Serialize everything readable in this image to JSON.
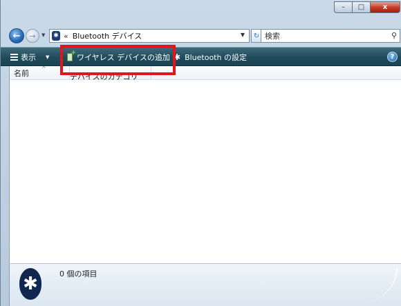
{
  "window": {
    "minimize_glyph": "–",
    "maximize_glyph": "□",
    "close_glyph": "x"
  },
  "nav": {
    "back_glyph": "←",
    "forward_glyph": "→"
  },
  "address": {
    "separator": "«",
    "path": "Bluetooth デバイス"
  },
  "search": {
    "placeholder": "検索"
  },
  "toolbar": {
    "views_label": "表示",
    "add_device_label": "ワイヤレス デバイスの追加",
    "bluetooth_settings_label": "Bluetooth の設定",
    "help_glyph": "?"
  },
  "columns": {
    "name": "名前",
    "category": "デバイスのカテゴリ"
  },
  "details": {
    "item_count": "0 個の項目"
  },
  "icons": {
    "bluetooth": "bluetooth-icon",
    "views": "views-icon",
    "add_device": "add-device-icon",
    "search": "search-icon",
    "refresh": "refresh-icon",
    "help": "help-icon"
  },
  "colors": {
    "toolbar": "#1f4b5c",
    "highlight": "#e3151a",
    "close_button": "#c6402a",
    "bluetooth_badge": "#10284f"
  }
}
